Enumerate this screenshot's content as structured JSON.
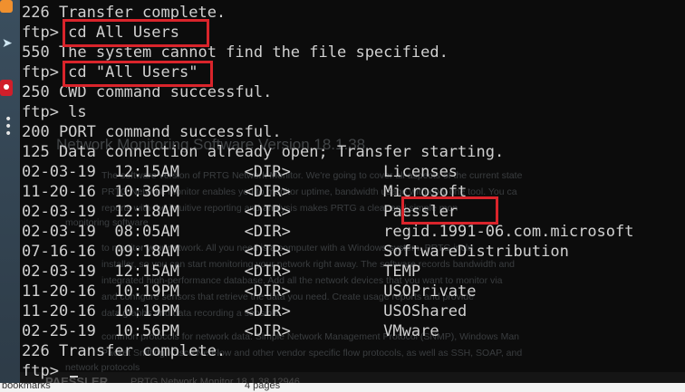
{
  "terminal": {
    "lines": [
      "226 Transfer complete.",
      "ftp> cd All Users",
      "550 The system cannot find the file specified.",
      "ftp> cd \"All Users\"",
      "250 CWD command successful.",
      "ftp> ls",
      "200 PORT command successful.",
      "125 Data connection already open; Transfer starting.",
      "02-03-19  12:15AM       <DIR>          Licenses",
      "11-20-16  10:36PM       <DIR>          Microsoft",
      "02-03-19  12:18AM       <DIR>          Paessler",
      "02-03-19  08:05AM       <DIR>          regid.1991-06.com.microsoft",
      "07-16-16  09:18AM       <DIR>          SoftwareDistribution",
      "02-03-19  12:15AM       <DIR>          TEMP",
      "11-20-16  10:19PM       <DIR>          USOPrivate",
      "11-20-16  10:19PM       <DIR>          USOShared",
      "02-25-19  10:56PM       <DIR>          VMware",
      "226 Transfer complete.",
      "ftp> "
    ]
  },
  "background_page": {
    "heading": "Network Monitoring Software Version 18.1.38",
    "lines": [
      "The software version of PRTG Network Monitor. We're going to cover all aspects of the current state",
      "PRTG Network Monitor enables you to monitor uptime, bandwidth usage with only one tool. You ca",
      "reports with the intuitive reporting and analysis makes PRTG a clear and simple mon",
      "monitoring software",
      "to monitor your network. All you need is a computer with a Windows system. PRTG inclu",
      "installer, so you can start monitoring your network right away. The software records bandwidth and",
      "integrated high-performance database. Add all the network devices that you want to monitor via",
      "and configure sensors that retrieve the data you need. Create usage reports and provide",
      "data graphs and data recording a sensible",
      "common protocols for network data: Simple Network Management Protocol (SNMP), Windows Man",
      "Packet Sniffing, Cisco NetFlow and other vendor specific flow protocols, as well as SSH, SOAP, and",
      "network protocols"
    ],
    "footer_logo": "PAESSLER",
    "footer_title": "PRTG Network Monitor 18.1.38.12946"
  },
  "statusbar": {
    "left": "bookmarks",
    "middle": "4 pages"
  },
  "colors": {
    "terminal_bg": "#0c0c0c",
    "terminal_text": "#d0d0d0",
    "highlight_box": "#d9242b"
  },
  "icons": [
    "app-tile-icon",
    "share-arrow-icon",
    "record-icon",
    "more-vertical-icon"
  ]
}
